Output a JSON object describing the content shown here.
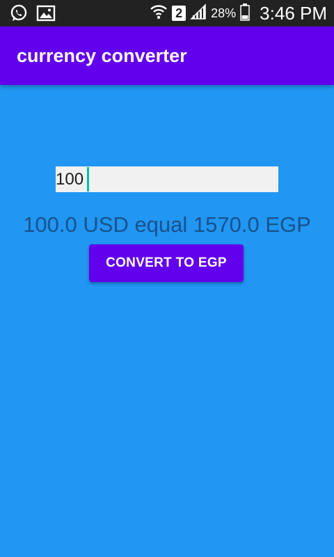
{
  "status_bar": {
    "icons": [
      "whatsapp-icon",
      "gallery-icon",
      "wifi-icon",
      "signal-icon",
      "battery-icon"
    ],
    "sim_slot": "2",
    "battery": "28%",
    "time": "3:46 PM"
  },
  "app_bar": {
    "title": "currency converter"
  },
  "converter": {
    "amount_value": "100",
    "result": "100.0 USD equal 1570.0 EGP",
    "convert_label": "CONVERT TO EGP"
  },
  "colors": {
    "background": "#2196f3",
    "app_bar": "#6200ee",
    "button": "#6200ee",
    "result_text": "#18528a",
    "caret": "#00bfa5"
  }
}
